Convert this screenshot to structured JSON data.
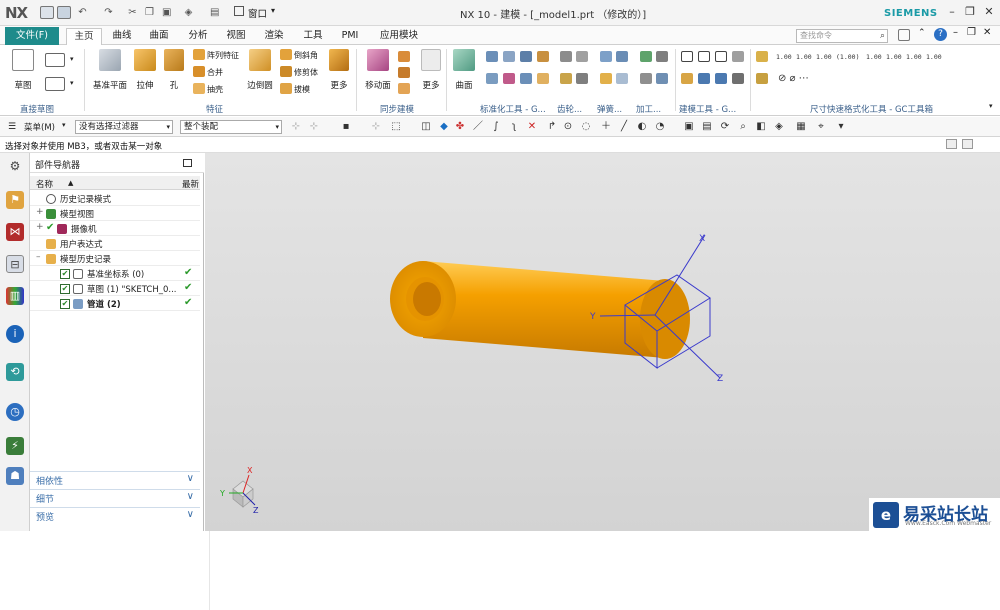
{
  "titlebar": {
    "logo": "NX",
    "title": "NX 10 - 建模 - [_model1.prt （修改的）]",
    "window_menu": "窗口",
    "brand": "SIEMENS",
    "min": "–",
    "max": "❐",
    "close": "✕"
  },
  "menubar": {
    "file": "文件(F)",
    "tabs": [
      "主页",
      "曲线",
      "曲面",
      "分析",
      "视图",
      "渲染",
      "工具",
      "PMI",
      "应用模块"
    ],
    "search_placeholder": "查找命令",
    "right_icons": [
      "help-icon",
      "minimize-icon",
      "restore-icon",
      "close-icon"
    ]
  },
  "ribbon": {
    "buttons": {
      "sketch": "草图",
      "datum_plane": "基准平面",
      "extrude": "拉伸",
      "hole": "孔",
      "pattern_feature": "阵列特征",
      "unite": "合并",
      "shell": "抽壳",
      "edge_blend": "边倒圆",
      "chamfer": "倒斜角",
      "trim_body": "修剪体",
      "draft": "拔模",
      "more1": "更多",
      "move_face": "移动面",
      "more2": "更多",
      "surface": "曲面"
    },
    "groups": [
      "直接草图",
      "特征",
      "同步建模",
      "标准化工具 - G...",
      "齿轮...",
      "弹簧...",
      "加工...",
      "建模工具 - G...",
      "尺寸快速格式化工具 - GC工具箱"
    ],
    "dim_labels": [
      "1.00",
      "1.00",
      "1.00",
      "(1.00)",
      "1.00",
      "1.00",
      "1.00",
      "1.00"
    ]
  },
  "toolbar2": {
    "menu_label": "菜单(M)",
    "filter_select": "没有选择过滤器",
    "assembly_select": "整个装配"
  },
  "status": "选择对象并使用 MB3，或者双击某一对象",
  "navigator": {
    "title": "部件导航器",
    "col_name": "名称",
    "col_latest": "最新",
    "rows": [
      {
        "label": "历史记录模式",
        "level": 1
      },
      {
        "label": "模型视图",
        "level": 1
      },
      {
        "label": "摄像机",
        "level": 1
      },
      {
        "label": "用户表达式",
        "level": 1
      },
      {
        "label": "模型历史记录",
        "level": 1
      },
      {
        "label": "基准坐标系 (0)",
        "level": 2
      },
      {
        "label": "草图 (1) \"SKETCH_0...",
        "level": 2
      },
      {
        "label": "管道 (2)",
        "level": 2
      }
    ],
    "check": "✔",
    "panels": [
      "相依性",
      "细节",
      "预览"
    ]
  },
  "viewport": {
    "axis_x": "X",
    "axis_y": "Y",
    "axis_z": "Z",
    "model_color": "#f5a000"
  },
  "watermark": {
    "icon": "e",
    "text": "易采站长站",
    "sub": "Www.Easck.Com Webmaster"
  }
}
